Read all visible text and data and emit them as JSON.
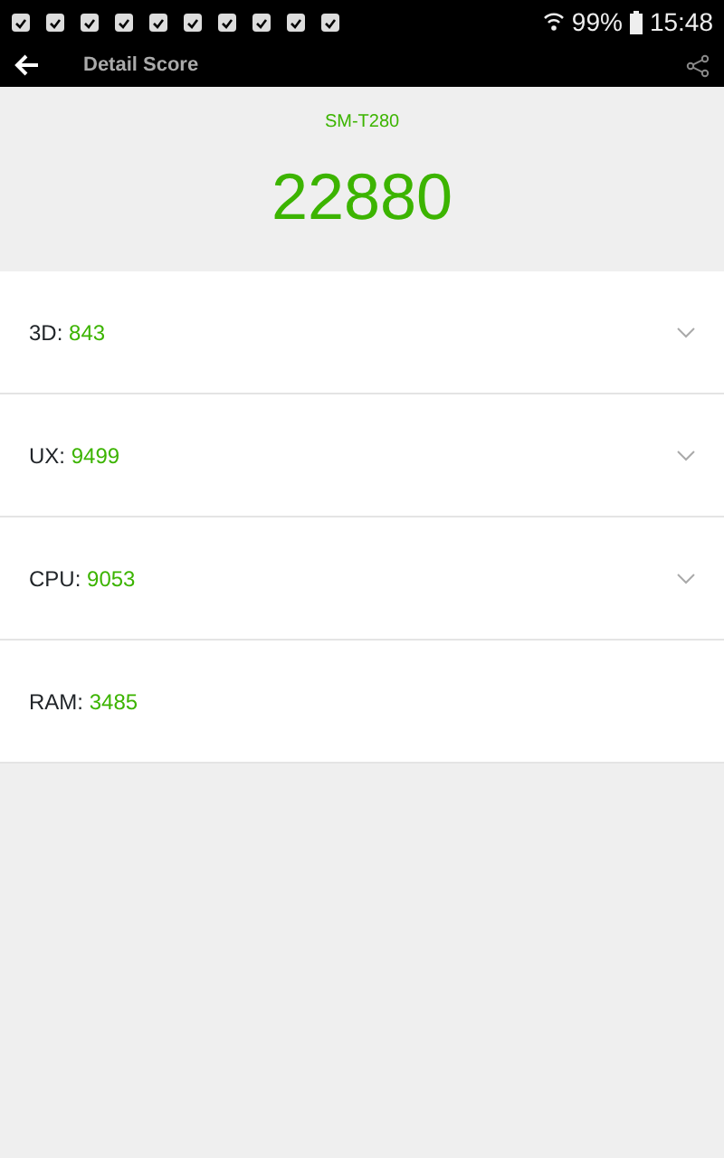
{
  "status_bar": {
    "battery": "99%",
    "time": "15:48"
  },
  "toolbar": {
    "title": "Detail Score"
  },
  "device": "SM-T280",
  "total_score": "22880",
  "scores": [
    {
      "label": "3D:",
      "value": "843",
      "expandable": true
    },
    {
      "label": "UX:",
      "value": "9499",
      "expandable": true
    },
    {
      "label": "CPU:",
      "value": "9053",
      "expandable": true
    },
    {
      "label": "RAM:",
      "value": "3485",
      "expandable": false
    }
  ]
}
